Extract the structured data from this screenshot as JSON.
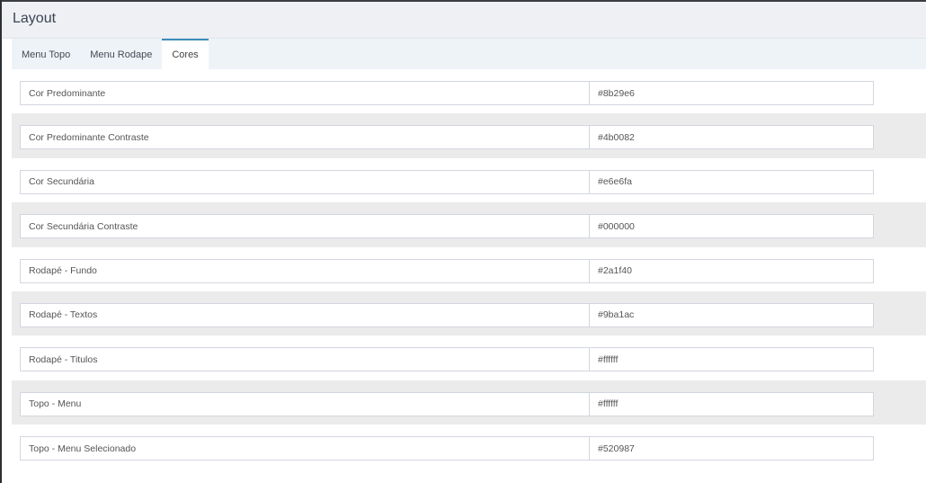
{
  "header": {
    "title": "Layout"
  },
  "tabs": [
    {
      "label": "Menu Topo",
      "active": false
    },
    {
      "label": "Menu Rodape",
      "active": false
    },
    {
      "label": "Cores",
      "active": true
    }
  ],
  "settings": [
    {
      "label": "Cor Predominante",
      "value": "#8b29e6"
    },
    {
      "label": "Cor Predominante Contraste",
      "value": "#4b0082"
    },
    {
      "label": "Cor Secundária",
      "value": "#e6e6fa"
    },
    {
      "label": "Cor Secundária Contraste",
      "value": "#000000"
    },
    {
      "label": "Rodapé - Fundo",
      "value": "#2a1f40"
    },
    {
      "label": "Rodapé - Textos",
      "value": "#9ba1ac"
    },
    {
      "label": "Rodapé - Titulos",
      "value": "#ffffff"
    },
    {
      "label": "Topo - Menu",
      "value": "#ffffff"
    },
    {
      "label": "Topo - Menu Selecionado",
      "value": "#520987"
    }
  ],
  "colors": {
    "active_tab_accent": "#3c8dbc",
    "header_bg": "#eef0f4",
    "alt_row_bg": "#ebebeb"
  }
}
